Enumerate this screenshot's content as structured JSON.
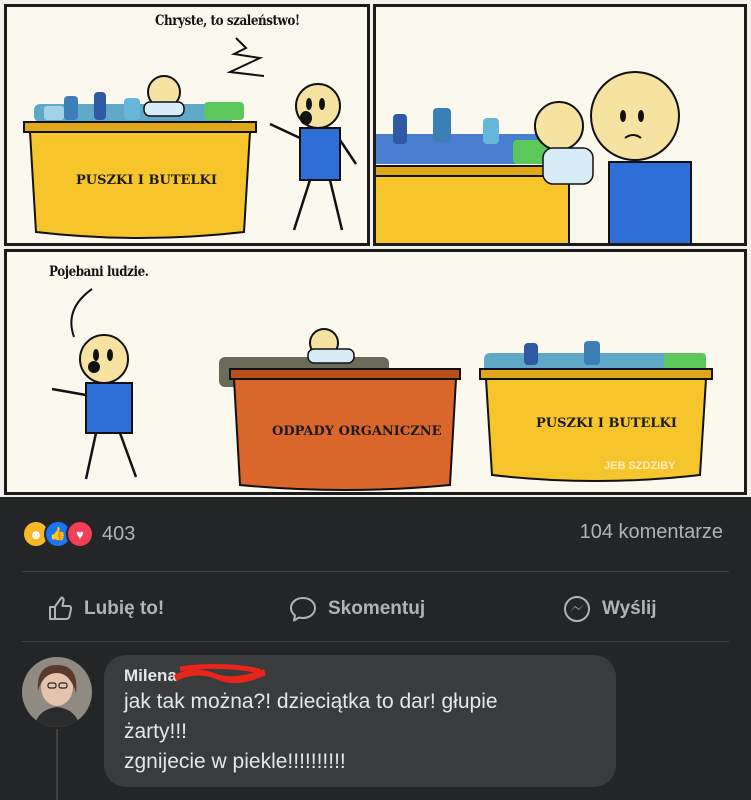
{
  "comic": {
    "panel1_caption": "Chryste, to szaleństwo!",
    "panel1_bin_label": "PUSZKI I BUTELKI",
    "panel3_caption": "Pojebani ludzie.",
    "organic_bin_label": "ODPADY ORGANICZNE",
    "recycle_bin_label": "PUSZKI I BUTELKI",
    "watermark": "JEB SZDZIBY"
  },
  "post": {
    "reaction_count": "403",
    "comments_count": "104 komentarze",
    "reaction_icons": [
      "haha-icon",
      "like-icon",
      "love-icon"
    ]
  },
  "actions": {
    "like": "Lubię to!",
    "comment": "Skomentuj",
    "send": "Wyślij"
  },
  "comment": {
    "author": "Milena",
    "lines": [
      "jak tak można?! dzieciątka to dar! głupie",
      "żarty!!!",
      "zgnijecie w piekle!!!!!!!!!!"
    ]
  },
  "colors": {
    "background": "#242526",
    "bubble": "#3a3b3c",
    "text": "#e4e6eb",
    "secondary_text": "#b0b3b8",
    "bin_yellow": "#f6c52c",
    "bin_orange": "#d9662a",
    "shirt_blue": "#2f6ed6",
    "redaction": "#e8251b"
  }
}
